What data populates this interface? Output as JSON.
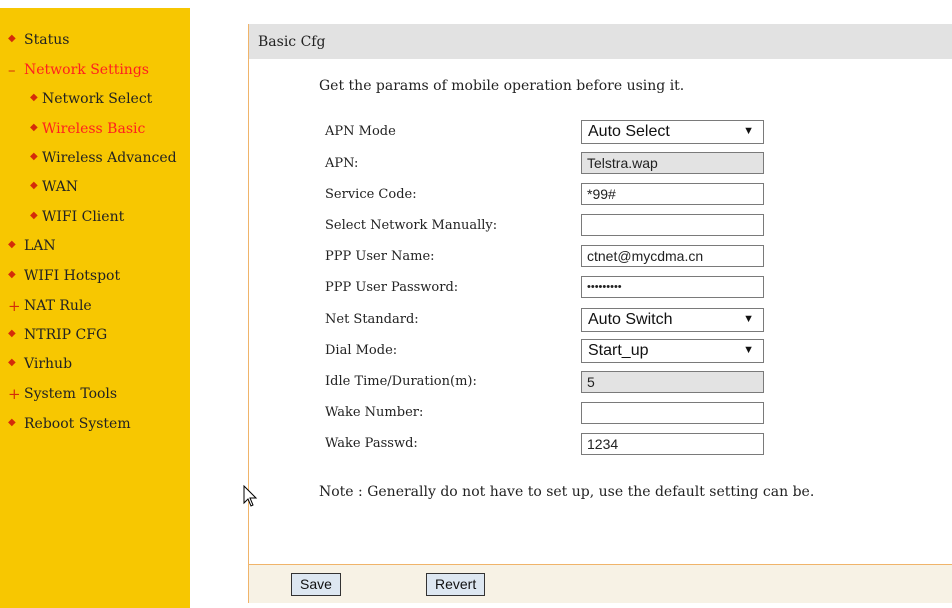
{
  "sidebar": {
    "items": [
      {
        "label": "Status"
      },
      {
        "label": "Network Settings"
      },
      {
        "label": "Network Select"
      },
      {
        "label": "Wireless Basic"
      },
      {
        "label": "Wireless Advanced"
      },
      {
        "label": "WAN"
      },
      {
        "label": "WIFI Client"
      },
      {
        "label": "LAN"
      },
      {
        "label": "WIFI Hotspot"
      },
      {
        "label": "NAT Rule"
      },
      {
        "label": "NTRIP CFG"
      },
      {
        "label": "Virhub"
      },
      {
        "label": "System Tools"
      },
      {
        "label": "Reboot System"
      }
    ],
    "active_color": "#ff1f1f",
    "bg_color": "#f7c701"
  },
  "panel": {
    "title": "Basic Cfg",
    "description": "Get the params of mobile operation before using it.",
    "fields": {
      "apn_mode": {
        "label": "APN Mode",
        "value": "Auto Select"
      },
      "apn": {
        "label": "APN:",
        "value": "Telstra.wap"
      },
      "service_code": {
        "label": "Service Code:",
        "value": "*99#"
      },
      "select_network": {
        "label": "Select Network Manually:",
        "value": ""
      },
      "ppp_user": {
        "label": "PPP User Name:",
        "value": "ctnet@mycdma.cn"
      },
      "ppp_password": {
        "label": "PPP User Password:",
        "value": "•••••••••"
      },
      "net_standard": {
        "label": "Net Standard:",
        "value": "Auto Switch"
      },
      "dial_mode": {
        "label": "Dial Mode:",
        "value": "Start_up"
      },
      "idle_time": {
        "label": "Idle Time/Duration(m):",
        "value": "5"
      },
      "wake_number": {
        "label": "Wake Number:",
        "value": ""
      },
      "wake_passwd": {
        "label": "Wake Passwd:",
        "value": "1234"
      }
    },
    "note": "Note : Generally do not have to set up, use the default setting can be.",
    "save_label": "Save",
    "revert_label": "Revert"
  }
}
